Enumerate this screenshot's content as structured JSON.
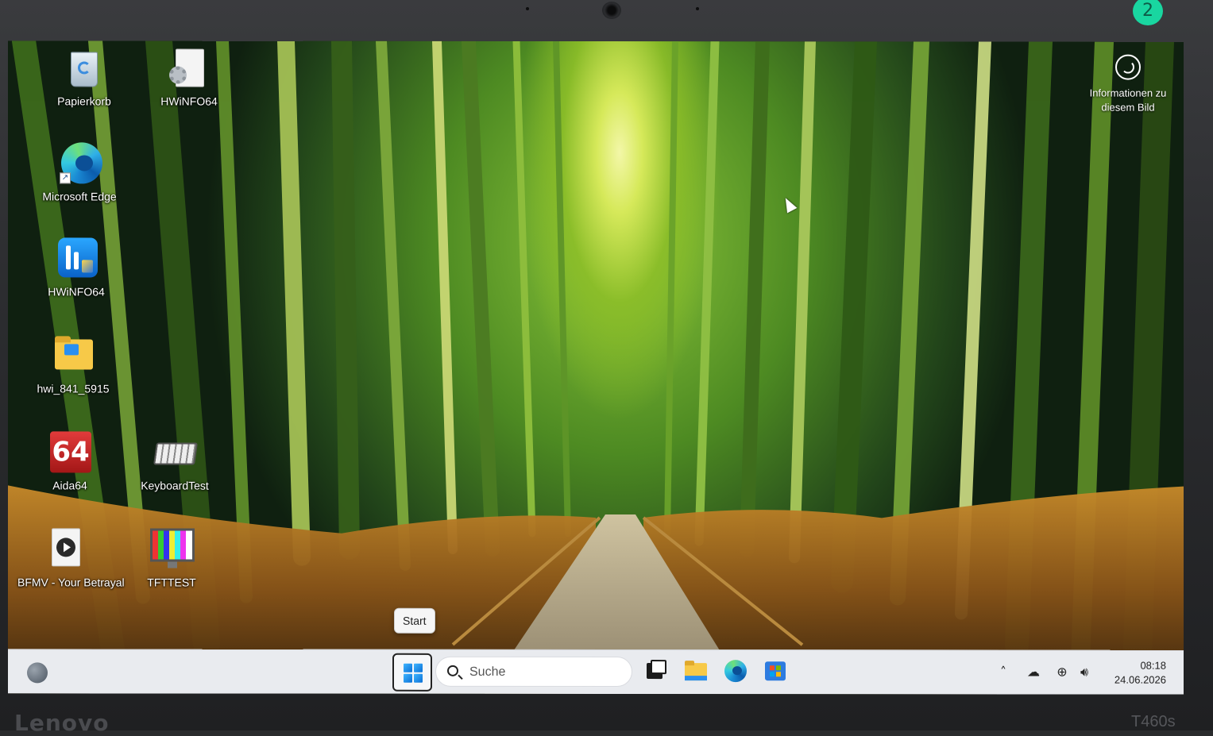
{
  "device": {
    "brand": "Lenovo",
    "model": "T460s",
    "sticker_label": "2"
  },
  "desktop_icons": [
    {
      "name": "recycle-bin",
      "label": "Papierkorb"
    },
    {
      "name": "hwinfo64-file",
      "label": "HWiNFO64"
    },
    {
      "name": "microsoft-edge",
      "label": "Microsoft Edge"
    },
    {
      "name": "hwinfo64-app",
      "label": "HWiNFO64"
    },
    {
      "name": "hwi-folder",
      "label": "hwi_841_5915"
    },
    {
      "name": "aida64",
      "label": "Aida64",
      "badge": "64"
    },
    {
      "name": "keyboardtest",
      "label": "KeyboardTest"
    },
    {
      "name": "bfmv-media",
      "label": "BFMV - Your Betrayal"
    },
    {
      "name": "tfttest",
      "label": "TFTTEST"
    }
  ],
  "spotlight": {
    "label": "Informationen zu diesem Bild"
  },
  "tooltip": {
    "text": "Start"
  },
  "taskbar": {
    "search_placeholder": "Suche",
    "clock_time": "08:18",
    "clock_date": "24.06.2026"
  },
  "colors": {
    "taskbar_bg": "#e9ebef",
    "accent_blue": "#0a6fd6",
    "folder_yellow": "#f7c948",
    "sticker_green": "#19d6a0"
  }
}
